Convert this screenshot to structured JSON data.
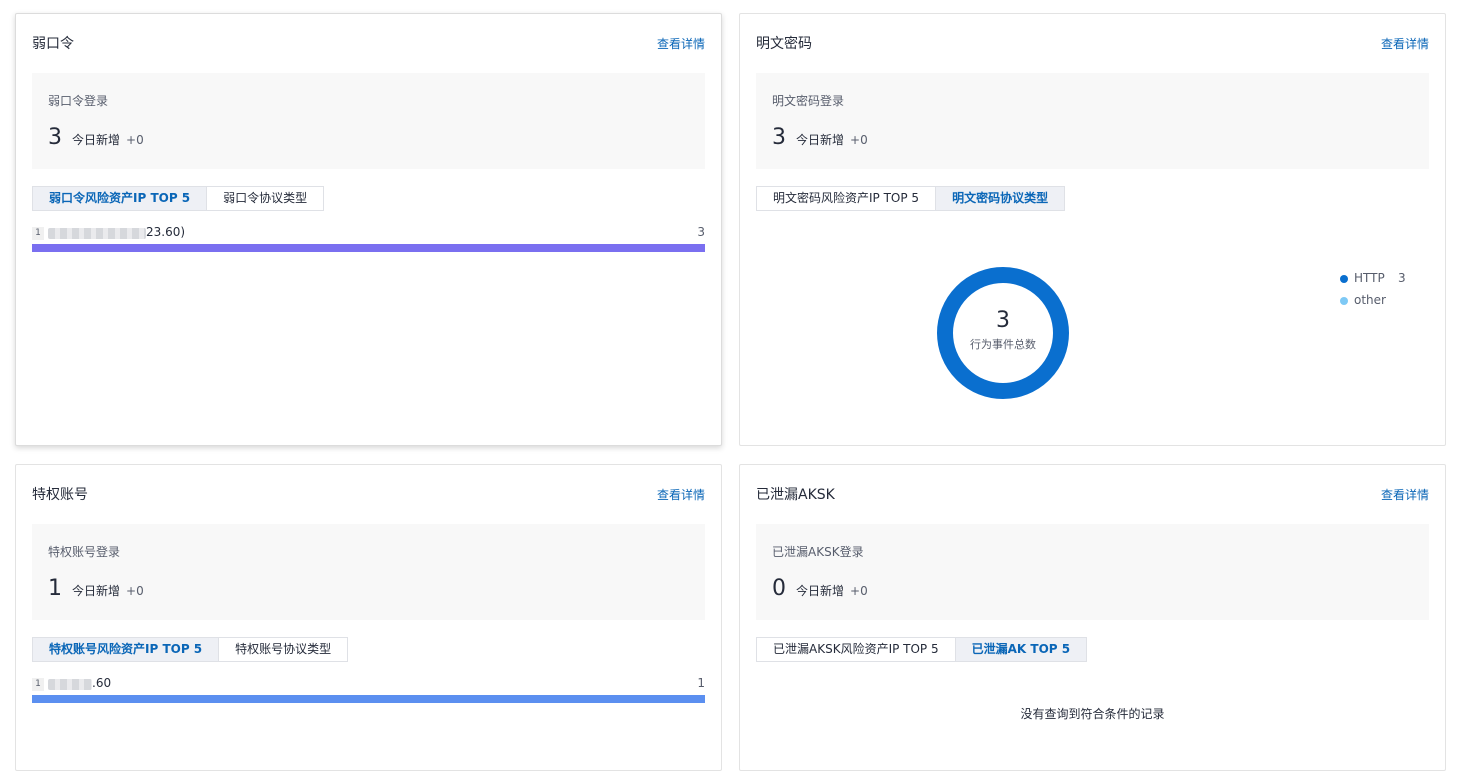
{
  "cards": [
    {
      "title": "弱口令",
      "link": "查看详情",
      "stat_label": "弱口令登录",
      "stat_value": "3",
      "stat_sub": "今日新增",
      "stat_inc": "+0",
      "tabs": [
        {
          "label": "弱口令风险资产IP TOP 5",
          "active": true
        },
        {
          "label": "弱口令协议类型",
          "active": false
        }
      ],
      "rank": [
        {
          "rank": "1",
          "ip_suffix": "23.60)",
          "value": "3",
          "bar_fraction": 1.0,
          "bar_color": "#7a6ff0"
        }
      ]
    },
    {
      "title": "明文密码",
      "link": "查看详情",
      "stat_label": "明文密码登录",
      "stat_value": "3",
      "stat_sub": "今日新增",
      "stat_inc": "+0",
      "tabs": [
        {
          "label": "明文密码风险资产IP TOP 5",
          "active": false
        },
        {
          "label": "明文密码协议类型",
          "active": true
        }
      ],
      "donut": {
        "total": "3",
        "center_label": "行为事件总数",
        "color_main": "#0a6fcf",
        "legend": [
          {
            "name": "HTTP",
            "value": "3",
            "color": "#0a6fcf"
          },
          {
            "name": "other",
            "value": "",
            "color": "#7ec9f5"
          }
        ]
      }
    },
    {
      "title": "特权账号",
      "link": "查看详情",
      "stat_label": "特权账号登录",
      "stat_value": "1",
      "stat_sub": "今日新增",
      "stat_inc": "+0",
      "tabs": [
        {
          "label": "特权账号风险资产IP TOP 5",
          "active": true
        },
        {
          "label": "特权账号协议类型",
          "active": false
        }
      ],
      "rank": [
        {
          "rank": "1",
          "ip_suffix": ".60",
          "value": "1",
          "bar_fraction": 1.0,
          "bar_color": "#5b8ff0"
        }
      ]
    },
    {
      "title": "已泄漏AKSK",
      "link": "查看详情",
      "stat_label": "已泄漏AKSK登录",
      "stat_value": "0",
      "stat_sub": "今日新增",
      "stat_inc": "+0",
      "tabs": [
        {
          "label": "已泄漏AKSK风险资产IP TOP 5",
          "active": false
        },
        {
          "label": "已泄漏AK TOP 5",
          "active": true
        }
      ],
      "empty": "没有查询到符合条件的记录"
    }
  ]
}
